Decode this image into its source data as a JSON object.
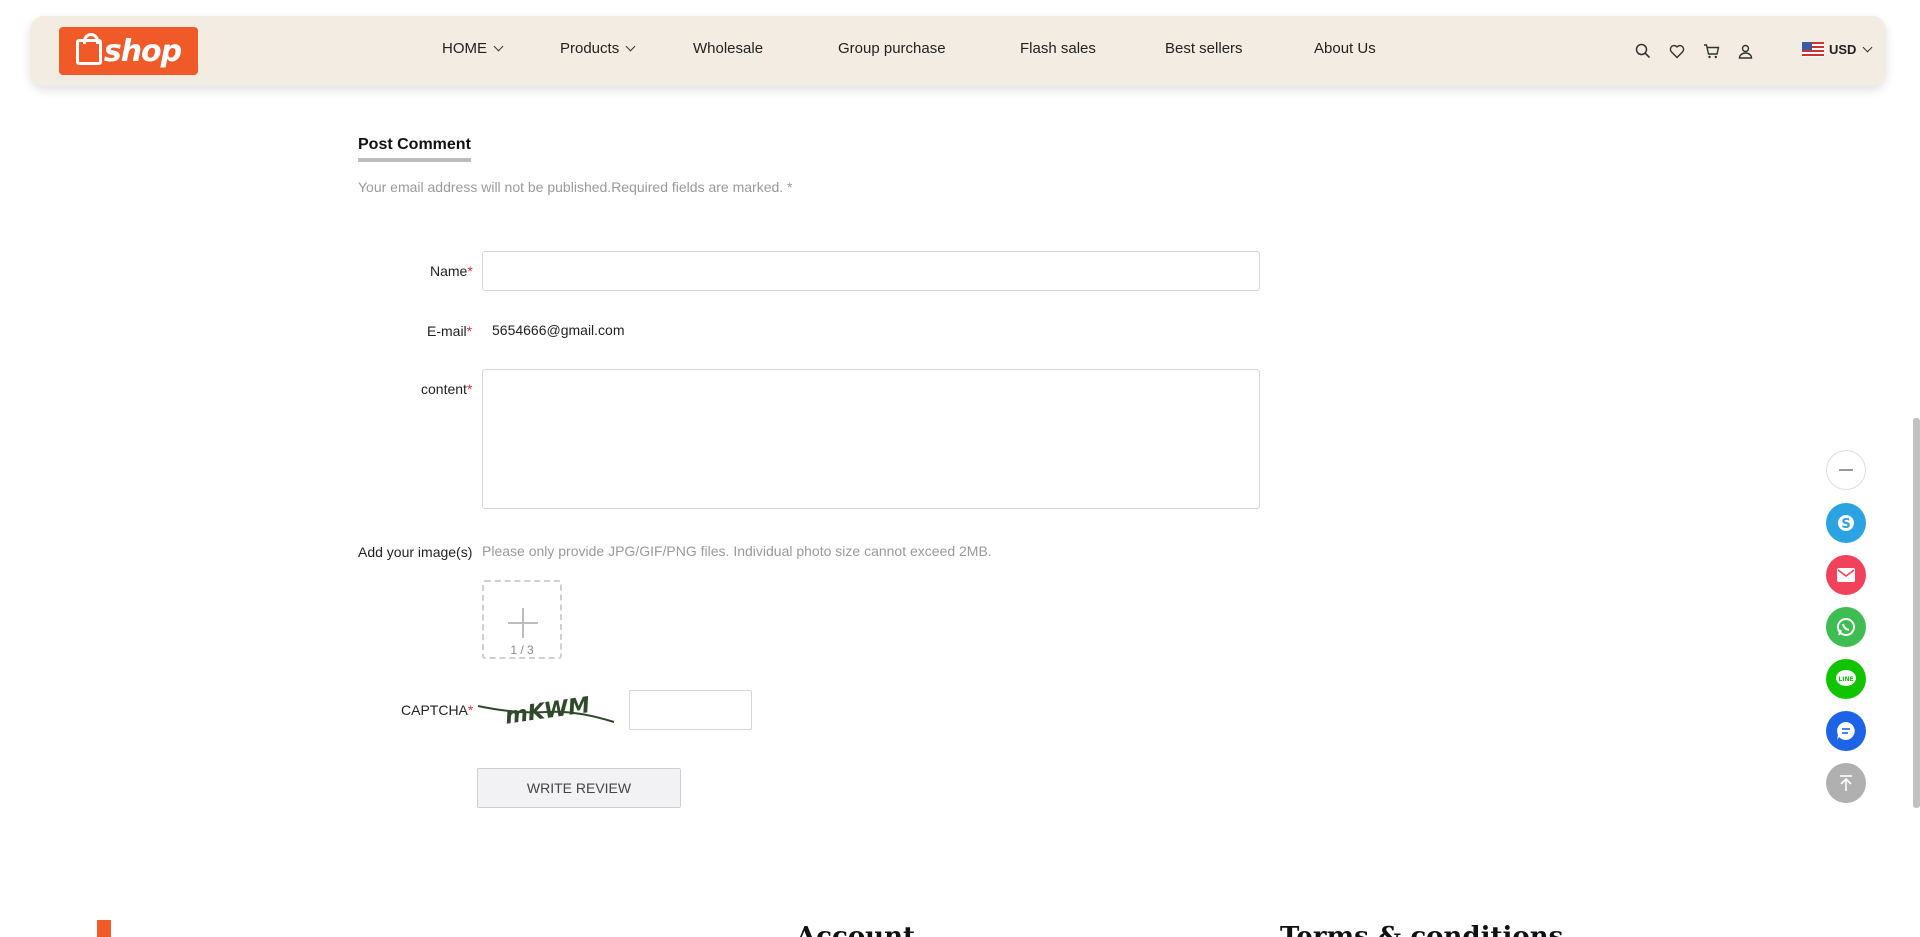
{
  "header": {
    "logo_text": "shop",
    "nav": [
      {
        "label": "HOME",
        "has_dropdown": true
      },
      {
        "label": "Products",
        "has_dropdown": true
      },
      {
        "label": "Wholesale",
        "has_dropdown": false
      },
      {
        "label": "Group purchase",
        "has_dropdown": false
      },
      {
        "label": "Flash sales",
        "has_dropdown": false
      },
      {
        "label": "Best sellers",
        "has_dropdown": false
      },
      {
        "label": "About Us",
        "has_dropdown": false
      }
    ],
    "icons": [
      "search-icon",
      "heart-icon",
      "cart-icon",
      "user-icon"
    ],
    "currency": "USD"
  },
  "form": {
    "title": "Post Comment",
    "note": "Your email address will not be published.Required fields are marked. *",
    "name_label": "Name",
    "name_value": "",
    "email_label": "E-mail",
    "email_value": "5654666@gmail.com",
    "content_label": "content",
    "content_value": "",
    "images_label": "Add your image(s)",
    "images_hint": "Please only provide JPG/GIF/PNG files. Individual photo size cannot exceed 2MB.",
    "upload_count": "1 / 3",
    "captcha_label": "CAPTCHA",
    "captcha_text": "mKWM",
    "captcha_value": "",
    "required_mark": "*",
    "submit_label": "WRITE REVIEW"
  },
  "floating": [
    {
      "name": "minimize-button",
      "icon": "minus-icon"
    },
    {
      "name": "skype-button",
      "icon": "skype-icon",
      "color": "#2ba3e3"
    },
    {
      "name": "email-button",
      "icon": "mail-icon",
      "color": "#f2415a"
    },
    {
      "name": "whatsapp-button",
      "icon": "whatsapp-icon",
      "color": "#3dbd52"
    },
    {
      "name": "line-button",
      "icon": "line-icon",
      "color": "#10c400"
    },
    {
      "name": "chat-button",
      "icon": "chat-icon",
      "color": "#1d63e6"
    },
    {
      "name": "back-to-top-button",
      "icon": "arrow-up-icon",
      "color": "#b0b0b0"
    }
  ],
  "footer": {
    "col2_heading": "Account",
    "col3_heading": "Terms & conditions"
  },
  "colors": {
    "brand": "#f05a28",
    "header_bg": "#f3ece2",
    "required": "#d0343a"
  }
}
